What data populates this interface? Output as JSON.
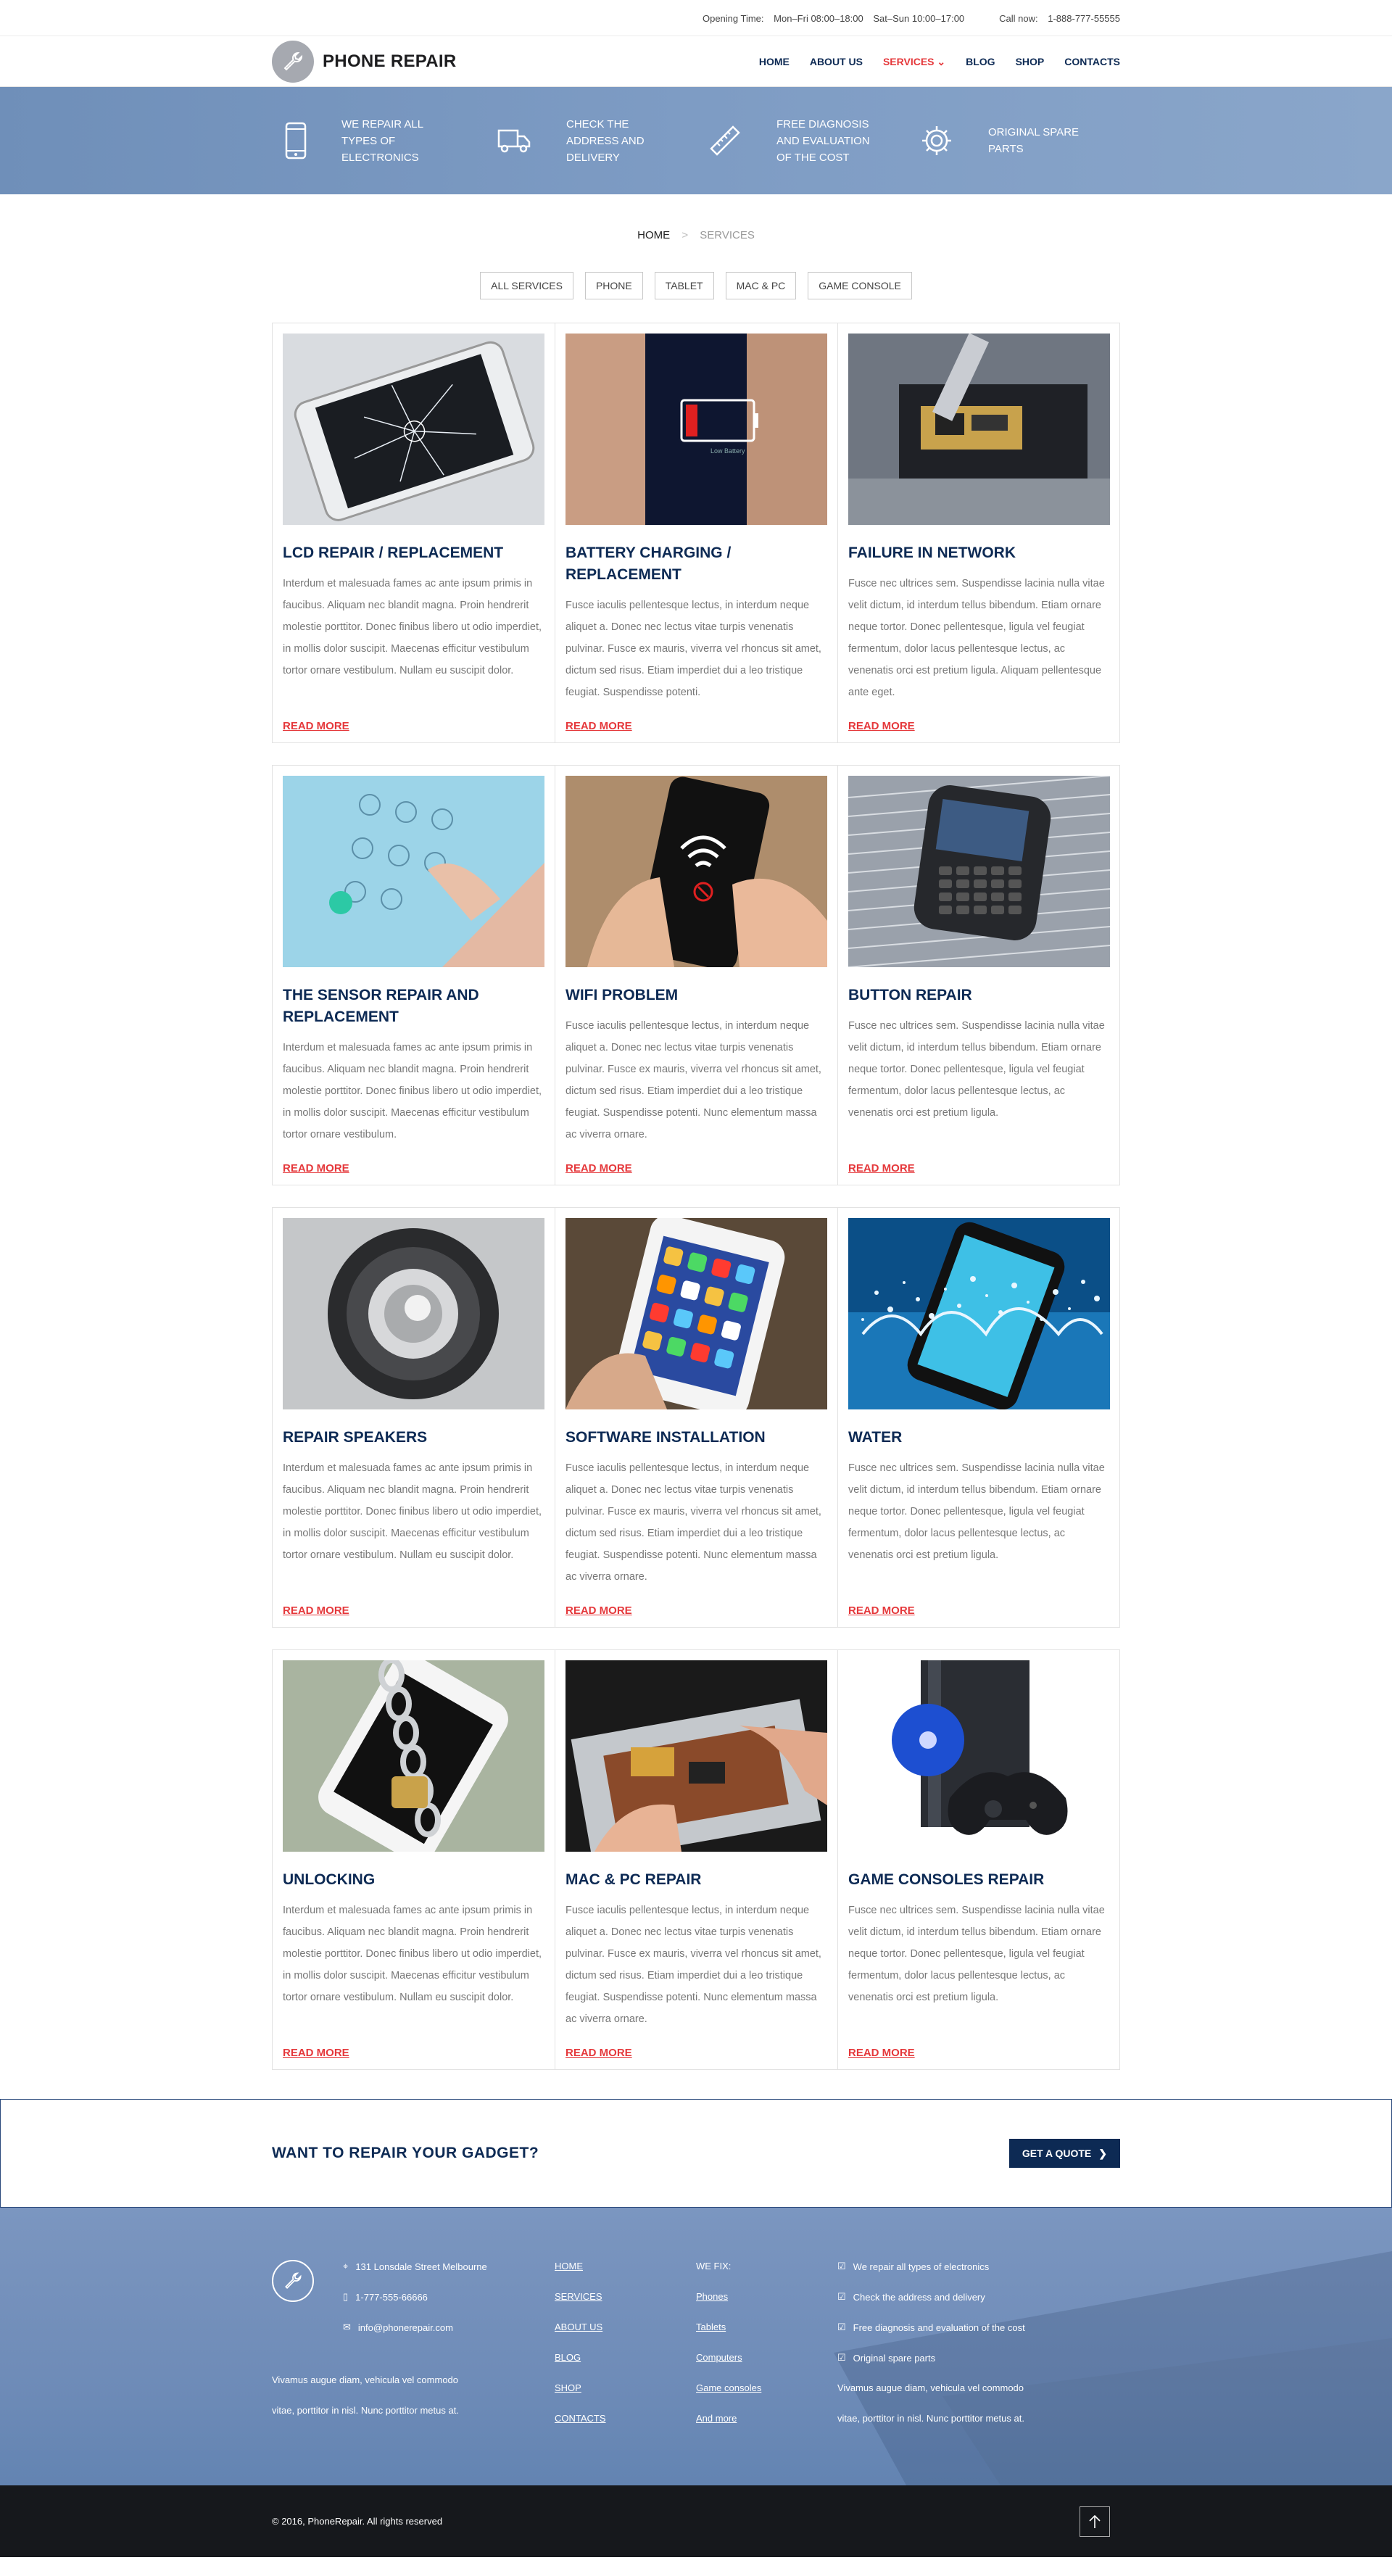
{
  "topbar": {
    "opening_label": "Opening Time:",
    "weekdays": "Mon–Fri 08:00–18:00",
    "weekend": "Sat–Sun 10:00–17:00",
    "call_label": "Call now:",
    "phone": "1-888-777-55555"
  },
  "header": {
    "logo_text": "PHONE REPAIR",
    "nav": [
      {
        "label": "HOME",
        "active": false
      },
      {
        "label": "ABOUT US",
        "active": false
      },
      {
        "label": "SERVICES",
        "active": true
      },
      {
        "label": "BLOG",
        "active": false
      },
      {
        "label": "SHOP",
        "active": false
      },
      {
        "label": "CONTACTS",
        "active": false
      }
    ]
  },
  "features": [
    {
      "icon": "smartphone-icon",
      "text": "We repair all types of electronics"
    },
    {
      "icon": "truck-icon",
      "text": "Check the address and delivery"
    },
    {
      "icon": "ruler-icon",
      "text": "Free diagnosis and evaluation of the cost"
    },
    {
      "icon": "gear-icon",
      "text": "Original spare parts"
    }
  ],
  "breadcrumb": {
    "home": "HOME",
    "separator": ">",
    "current": "SERVICES"
  },
  "filters": [
    "ALL SERVICES",
    "PHONE",
    "TABLET",
    "MAC & PC",
    "GAME CONSOLE"
  ],
  "read_more": "READ MORE",
  "services": [
    {
      "title": "LCD REPAIR / REPLACEMENT",
      "img": "cracked-screen",
      "text": "Interdum et malesuada fames ac ante ipsum primis in faucibus. Aliquam nec blandit magna. Proin hendrerit molestie porttitor. Donec finibus libero ut odio imperdiet, in mollis dolor suscipit. Maecenas efficitur vestibulum tortor ornare vestibulum. Nullam eu suscipit dolor."
    },
    {
      "title": "BATTERY CHARGING / REPLACEMENT",
      "img": "low-battery",
      "text": "Fusce iaculis pellentesque lectus, in interdum neque aliquet a. Donec nec lectus vitae turpis venenatis pulvinar. Fusce ex mauris, viverra vel rhoncus sit amet, dictum sed risus. Etiam imperdiet dui a leo tristique feugiat. Suspendisse potenti."
    },
    {
      "title": "FAILURE IN NETWORK",
      "img": "circuit-board",
      "text": "Fusce nec ultrices sem. Suspendisse lacinia nulla vitae velit dictum, id interdum tellus bibendum. Etiam ornare neque tortor. Donec pellentesque, ligula vel feugiat fermentum, dolor lacus pellentesque lectus, ac venenatis orci est pretium ligula. Aliquam pellentesque ante eget."
    },
    {
      "title": "THE SENSOR REPAIR AND REPLACEMENT",
      "img": "dial-pad",
      "text": "Interdum et malesuada fames ac ante ipsum primis in faucibus. Aliquam nec blandit magna. Proin hendrerit molestie porttitor. Donec finibus libero ut odio imperdiet, in mollis dolor suscipit. Maecenas efficitur vestibulum tortor ornare vestibulum."
    },
    {
      "title": "WIFI PROBLEM",
      "img": "wifi-phone",
      "text": "Fusce iaculis pellentesque lectus, in interdum neque aliquet a. Donec nec lectus vitae turpis venenatis pulvinar. Fusce ex mauris, viverra vel rhoncus sit amet, dictum sed risus. Etiam imperdiet dui a leo tristique feugiat. Suspendisse potenti. Nunc elementum massa ac viverra ornare."
    },
    {
      "title": "BUTTON REPAIR",
      "img": "keyboard-phone",
      "text": "Fusce nec ultrices sem. Suspendisse lacinia nulla vitae velit dictum, id interdum tellus bibendum. Etiam ornare neque tortor. Donec pellentesque, ligula vel feugiat fermentum, dolor lacus pellentesque lectus, ac venenatis orci est pretium ligula."
    },
    {
      "title": "REPAIR SPEAKERS",
      "img": "speaker",
      "text": "Interdum et malesuada fames ac ante ipsum primis in faucibus. Aliquam nec blandit magna. Proin hendrerit molestie porttitor. Donec finibus libero ut odio imperdiet, in mollis dolor suscipit. Maecenas efficitur vestibulum tortor ornare vestibulum. Nullam eu suscipit dolor."
    },
    {
      "title": "SOFTWARE INSTALLATION",
      "img": "iphone-apps",
      "text": "Fusce iaculis pellentesque lectus, in interdum neque aliquet a. Donec nec lectus vitae turpis venenatis pulvinar. Fusce ex mauris, viverra vel rhoncus sit amet, dictum sed risus. Etiam imperdiet dui a leo tristique feugiat. Suspendisse potenti. Nunc elementum massa ac viverra ornare."
    },
    {
      "title": "WATER",
      "img": "water-splash",
      "text": "Fusce nec ultrices sem. Suspendisse lacinia nulla vitae velit dictum, id interdum tellus bibendum. Etiam ornare neque tortor. Donec pellentesque, ligula vel feugiat fermentum, dolor lacus pellentesque lectus, ac venenatis orci est pretium ligula."
    },
    {
      "title": "UNLOCKING",
      "img": "chained-phone",
      "text": "Interdum et malesuada fames ac ante ipsum primis in faucibus. Aliquam nec blandit magna. Proin hendrerit molestie porttitor. Donec finibus libero ut odio imperdiet, in mollis dolor suscipit. Maecenas efficitur vestibulum tortor ornare vestibulum. Nullam eu suscipit dolor."
    },
    {
      "title": "MAC & PC REPAIR",
      "img": "laptop-repair",
      "text": "Fusce iaculis pellentesque lectus, in interdum neque aliquet a. Donec nec lectus vitae turpis venenatis pulvinar. Fusce ex mauris, viverra vel rhoncus sit amet, dictum sed risus. Etiam imperdiet dui a leo tristique feugiat. Suspendisse potenti. Nunc elementum massa ac viverra ornare."
    },
    {
      "title": "GAME CONSOLES REPAIR",
      "img": "game-console",
      "text": "Fusce nec ultrices sem. Suspendisse lacinia nulla vitae velit dictum, id interdum tellus bibendum. Etiam ornare neque tortor. Donec pellentesque, ligula vel feugiat fermentum, dolor lacus pellentesque lectus, ac venenatis orci est pretium ligula."
    }
  ],
  "cta": {
    "title": "WANT TO REPAIR YOUR GADGET?",
    "button": "GET A QUOTE"
  },
  "footer": {
    "address": "131 Lonsdale Street Melbourne",
    "phone": "1-777-555-66666",
    "email": "info@phonerepair.com",
    "about_line1": "Vivamus augue diam, vehicula vel commodo",
    "about_line2": "vitae, porttitor in nisl. Nunc porttitor metus at.",
    "links": [
      "HOME",
      "SERVICES",
      "ABOUT US",
      "BLOG",
      "SHOP",
      "CONTACTS"
    ],
    "fix_title": "WE FIX:",
    "fix_items": [
      "Phones",
      "Tablets",
      "Computers",
      "Game consoles",
      "And more"
    ],
    "checks": [
      "We repair all types of electronics",
      "Check the address and delivery",
      "Free diagnosis and evaluation of the cost",
      "Original spare parts"
    ],
    "text_line1": "Vivamus augue diam, vehicula vel commodo",
    "text_line2": "vitae, porttitor in nisl. Nunc porttitor metus at."
  },
  "copyright": "© 2016, PhoneRepair. All rights reserved",
  "colors": {
    "accent": "#e5383b",
    "navy": "#0d2a54",
    "band": "#7e9cc4"
  }
}
